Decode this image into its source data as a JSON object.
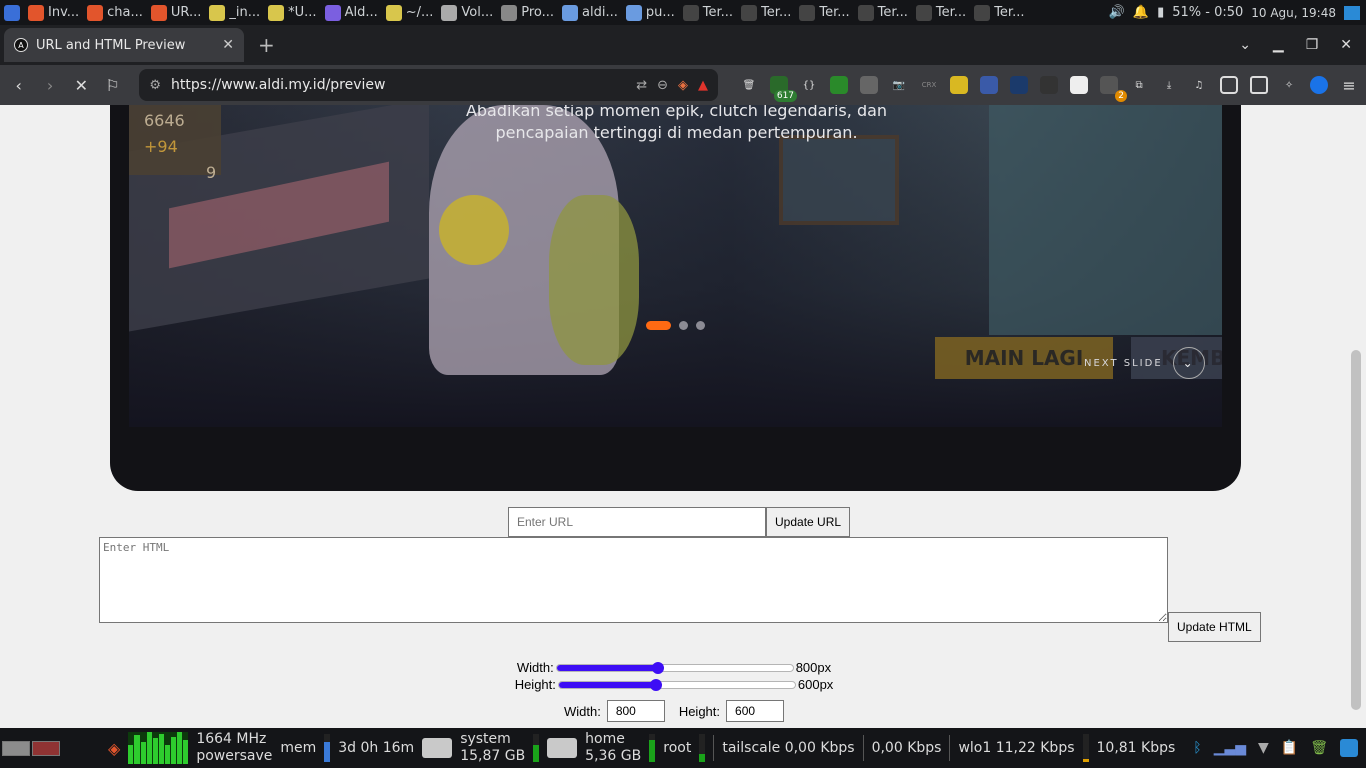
{
  "topbar": {
    "tasks": [
      {
        "label": "Inv...",
        "color": "#e2552c"
      },
      {
        "label": "cha...",
        "color": "#e2552c"
      },
      {
        "label": "UR...",
        "color": "#e2552c"
      },
      {
        "label": "_in...",
        "color": "#d8c64c"
      },
      {
        "label": "*U...",
        "color": "#d8c64c"
      },
      {
        "label": "Ald...",
        "color": "#7b5fe0"
      },
      {
        "label": "~/...",
        "color": "#d8c64c"
      },
      {
        "label": "Vol...",
        "color": "#aaaaaa"
      },
      {
        "label": "Pro...",
        "color": "#888888"
      },
      {
        "label": "aldi...",
        "color": "#6a9be0"
      },
      {
        "label": "pu...",
        "color": "#6a9be0"
      },
      {
        "label": "Ter...",
        "color": "#444444"
      },
      {
        "label": "Ter...",
        "color": "#444444"
      },
      {
        "label": "Ter...",
        "color": "#444444"
      },
      {
        "label": "Ter...",
        "color": "#444444"
      },
      {
        "label": "Ter...",
        "color": "#444444"
      },
      {
        "label": "Ter...",
        "color": "#444444"
      }
    ],
    "battery": "51% - 0:50",
    "datetime": "10 Agu, 19:48"
  },
  "browser": {
    "tab_title": "URL and HTML Preview",
    "url": "https://www.aldi.my.id/preview",
    "badge_count": "617",
    "badge_count2": "2"
  },
  "hero": {
    "tagline": "Abadikan setiap momen epik, clutch legendaris, dan pencapaian tertinggi di medan pertempuran.",
    "score_main": "6646",
    "score_plus": "+94",
    "score_sub": "9",
    "main_lagi": "MAIN LAGI",
    "kembali": "KEMBA",
    "next_slide": "NEXT SLIDE",
    "accent": "#ff6a13"
  },
  "form": {
    "url_placeholder": "Enter URL",
    "update_url": "Update URL",
    "html_placeholder": "Enter HTML",
    "update_html": "Update HTML",
    "width_label": "Width:",
    "height_label": "Height:",
    "width_value": "800px",
    "height_value": "600px",
    "width_fraction": 0.43,
    "height_fraction": 0.41,
    "width_num_label": "Width:",
    "height_num_label": "Height:",
    "width_num": "800",
    "height_num": "600",
    "slider_color": "#3d0ef5"
  },
  "bottombar": {
    "cpu_freq": "1664 MHz",
    "cpu_gov": "powersave",
    "mem_label": "mem",
    "uptime": "3d 0h 16m",
    "system_label": "system",
    "system_size": "15,87 GB",
    "home_label": "home",
    "home_size": "5,36 GB",
    "root_label": "root",
    "tailscale": "tailscale 0,00 Kbps",
    "tailscale2": "0,00 Kbps",
    "wlo1": "wlo1 11,22 Kbps",
    "wlo1_2": "10,81 Kbps"
  }
}
